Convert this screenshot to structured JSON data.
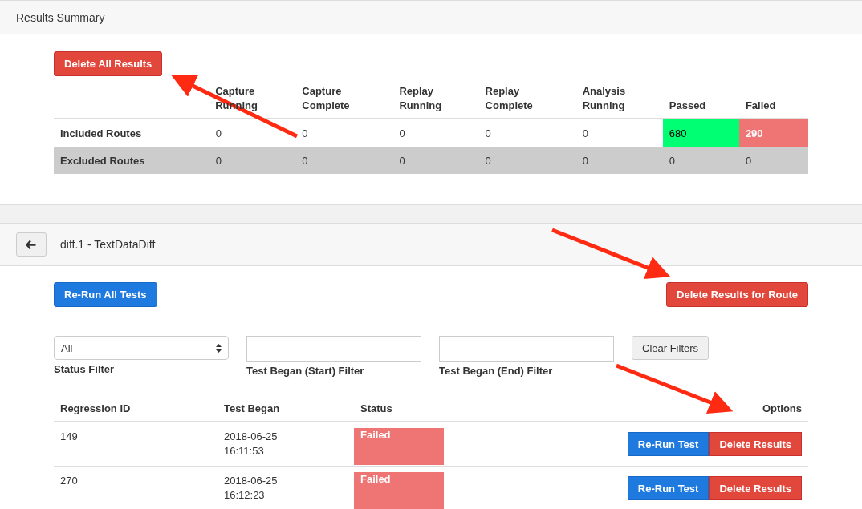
{
  "summary_panel": {
    "title": "Results Summary",
    "delete_all_button": "Delete All Results",
    "columns": [
      "",
      "Capture Running",
      "Capture Complete",
      "Replay Running",
      "Replay Complete",
      "Analysis Running",
      "Passed",
      "Failed"
    ],
    "rows": [
      {
        "kind": "plain",
        "cells": [
          {
            "text": "Included Routes",
            "kind": "label"
          },
          {
            "text": "0",
            "kind": "plain"
          },
          {
            "text": "0",
            "kind": "plain"
          },
          {
            "text": "0",
            "kind": "plain"
          },
          {
            "text": "0",
            "kind": "plain"
          },
          {
            "text": "0",
            "kind": "plain"
          },
          {
            "text": "680",
            "kind": "passed"
          },
          {
            "text": "290",
            "kind": "failed"
          }
        ]
      },
      {
        "kind": "muted",
        "cells": [
          {
            "text": "Excluded Routes",
            "kind": "label"
          },
          {
            "text": "0",
            "kind": "plain"
          },
          {
            "text": "0",
            "kind": "plain"
          },
          {
            "text": "0",
            "kind": "plain"
          },
          {
            "text": "0",
            "kind": "plain"
          },
          {
            "text": "0",
            "kind": "plain"
          },
          {
            "text": "0",
            "kind": "plain"
          },
          {
            "text": "0",
            "kind": "plain"
          }
        ]
      }
    ]
  },
  "route_panel": {
    "title": "diff.1 - TextDataDiff",
    "rerun_all_button": "Re-Run All Tests",
    "delete_route_button": "Delete Results for Route",
    "filters": {
      "status": {
        "value": "All",
        "label": "Status Filter"
      },
      "start": {
        "label": "Test Began (Start) Filter"
      },
      "end": {
        "label": "Test Began (End) Filter"
      },
      "clear_button": "Clear Filters"
    },
    "columns": [
      "Regression ID",
      "Test Began",
      "Status",
      "Options"
    ],
    "rows": [
      {
        "id": "149",
        "began": "2018-06-25\n16:11:53",
        "status": "Failed",
        "kind": "failed",
        "rerun_button": "Re-Run Test",
        "delete_button": "Delete Results"
      },
      {
        "id": "270",
        "began": "2018-06-25\n16:12:23",
        "status": "Failed",
        "kind": "failed",
        "rerun_button": "Re-Run Test",
        "delete_button": "Delete Results"
      }
    ]
  }
}
